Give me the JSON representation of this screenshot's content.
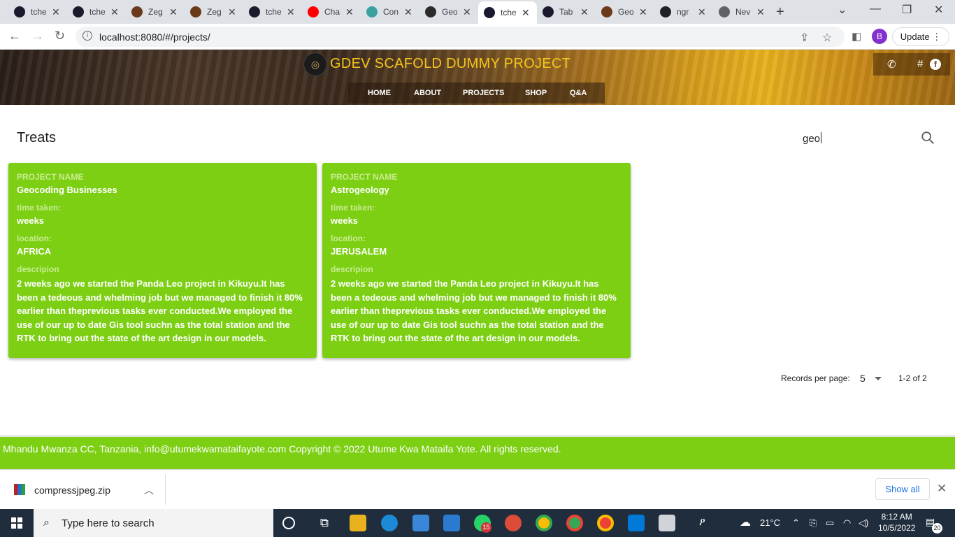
{
  "browser": {
    "tabs": [
      {
        "title": "tche",
        "color": "#1a1a2e"
      },
      {
        "title": "tche",
        "color": "#1a1a2e"
      },
      {
        "title": "Zeg",
        "color": "#6b3a1a"
      },
      {
        "title": "Zeg",
        "color": "#6b3a1a"
      },
      {
        "title": "tche",
        "color": "#1a1a2e"
      },
      {
        "title": "Cha",
        "color": "#ff0000"
      },
      {
        "title": "Con",
        "color": "#3aa0a0"
      },
      {
        "title": "Geo",
        "color": "#2b2b2b"
      },
      {
        "title": "tche",
        "color": "#1a1a2e"
      },
      {
        "title": "Tab",
        "color": "#1a1a2e"
      },
      {
        "title": "Geo",
        "color": "#6b3a1a"
      },
      {
        "title": "ngr",
        "color": "#202124"
      },
      {
        "title": "Nev",
        "color": "#5f6368"
      }
    ],
    "active_tab_index": 8,
    "url": "localhost:8080/#/projects/",
    "profile_initial": "B",
    "update_label": "Update"
  },
  "site": {
    "title": "GDEV SCAFOLD DUMMY PROJECT",
    "nav": [
      "HOME",
      "ABOUT",
      "PROJECTS",
      "SHOP",
      "Q&A"
    ],
    "contact_icons": [
      "phone-icon",
      "hash-icon",
      "facebook-icon"
    ]
  },
  "page": {
    "heading": "Treats",
    "search_value": "geo"
  },
  "projects": [
    {
      "name_label": "PROJECT NAME",
      "name": "Geocoding Businesses",
      "time_label": "time taken:",
      "time": "weeks",
      "location_label": "location:",
      "location": "AFRICA",
      "description_label": "descripion",
      "description": "2 weeks ago we started the Panda Leo project in Kikuyu.It has been a tedeous and whelming job but we managed to finish it 80% earlier than theprevious tasks ever conducted.We employed the use of our up to date Gis tool suchn as the total station and the RTK to bring out the state of the art design in our models."
    },
    {
      "name_label": "PROJECT NAME",
      "name": "Astrogeology",
      "time_label": "time taken:",
      "time": "weeks",
      "location_label": "location:",
      "location": "JERUSALEM",
      "description_label": "descripion",
      "description": "2 weeks ago we started the Panda Leo project in Kikuyu.It has been a tedeous and whelming job but we managed to finish it 80% earlier than theprevious tasks ever conducted.We employed the use of our up to date Gis tool suchn as the total station and the RTK to bring out the state of the art design in our models."
    }
  ],
  "pagination": {
    "label": "Records per page:",
    "per_page": "5",
    "range": "1-2 of 2"
  },
  "footer": {
    "text": "Mhandu Mwanza CC, Tanzania, info@utumekwamataifayote.com Copyright © 2022 Utume Kwa Mataifa Yote. All rights reserved."
  },
  "download_bar": {
    "file": "compressjpeg.zip",
    "show_all": "Show all"
  },
  "taskbar": {
    "search_placeholder": "Type here to search",
    "whatsapp_badge": "15",
    "weather": "21°C",
    "time": "8:12 AM",
    "date": "10/5/2022",
    "notifications": "20"
  },
  "colors": {
    "card_green": "#7ccf13",
    "title_yellow": "#f5c518"
  }
}
